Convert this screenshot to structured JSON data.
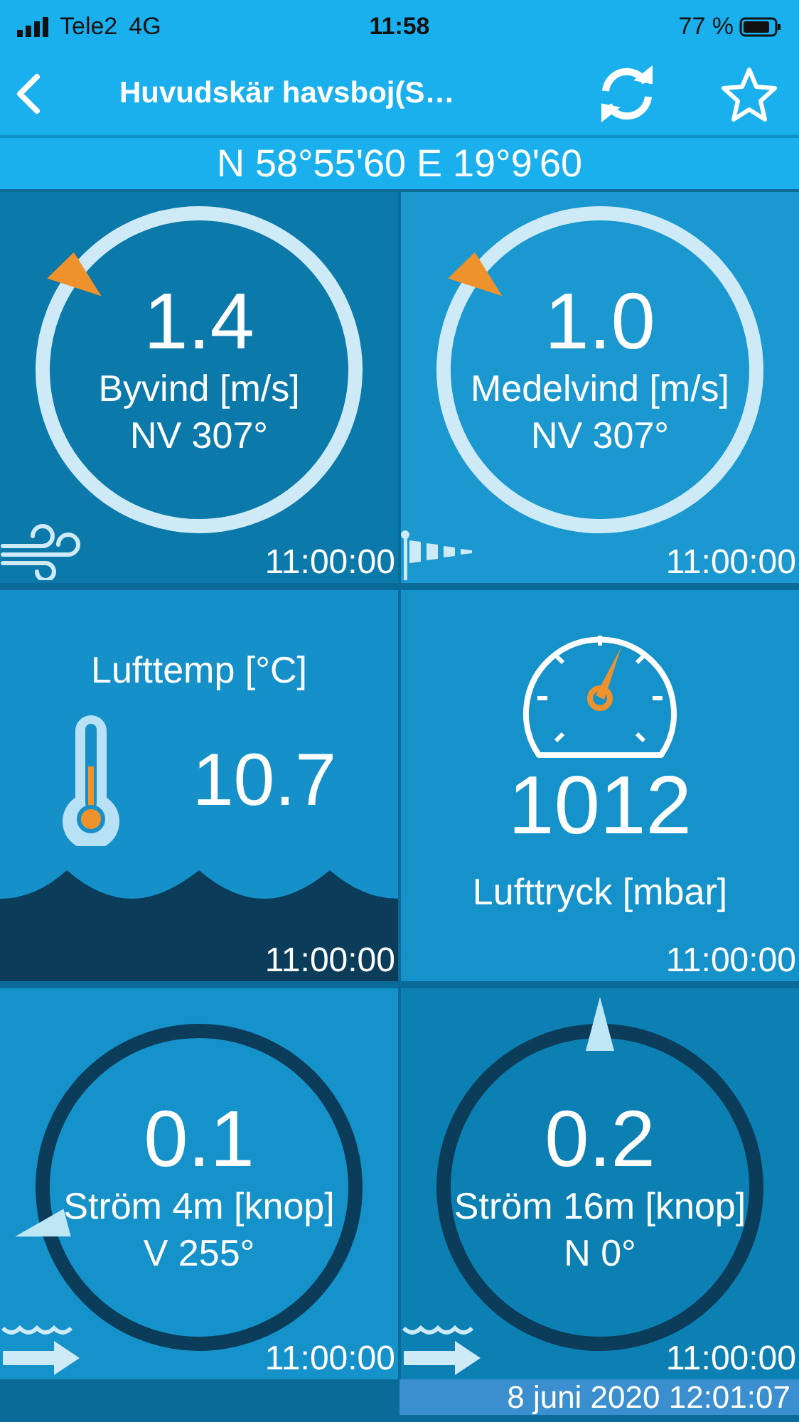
{
  "status_bar": {
    "carrier": "Tele2",
    "network": "4G",
    "time": "11:58",
    "battery": "77 %"
  },
  "nav": {
    "title": "Huvudskär havsboj(S…"
  },
  "coordinates": "N 58°55'60 E 19°9'60",
  "tiles": [
    {
      "kind": "gust",
      "value": "1.4",
      "label": "Byvind [m/s]",
      "direction": "NV 307°",
      "time": "11:00:00"
    },
    {
      "kind": "mean",
      "value": "1.0",
      "label": "Medelvind [m/s]",
      "direction": "NV 307°",
      "time": "11:00:00"
    },
    {
      "kind": "temp",
      "label": "Lufttemp [°C]",
      "value": "10.7",
      "time": "11:00:00"
    },
    {
      "kind": "pressure",
      "value": "1012",
      "label": "Lufttryck [mbar]",
      "time": "11:00:00"
    },
    {
      "kind": "current",
      "value": "0.1",
      "label": "Ström 4m [knop]",
      "direction": "V 255°",
      "time": "11:00:00"
    },
    {
      "kind": "current",
      "value": "0.2",
      "label": "Ström 16m [knop]",
      "direction": "N 0°",
      "time": "11:00:00"
    }
  ],
  "updated": "8 juni 2020 12:01:07"
}
